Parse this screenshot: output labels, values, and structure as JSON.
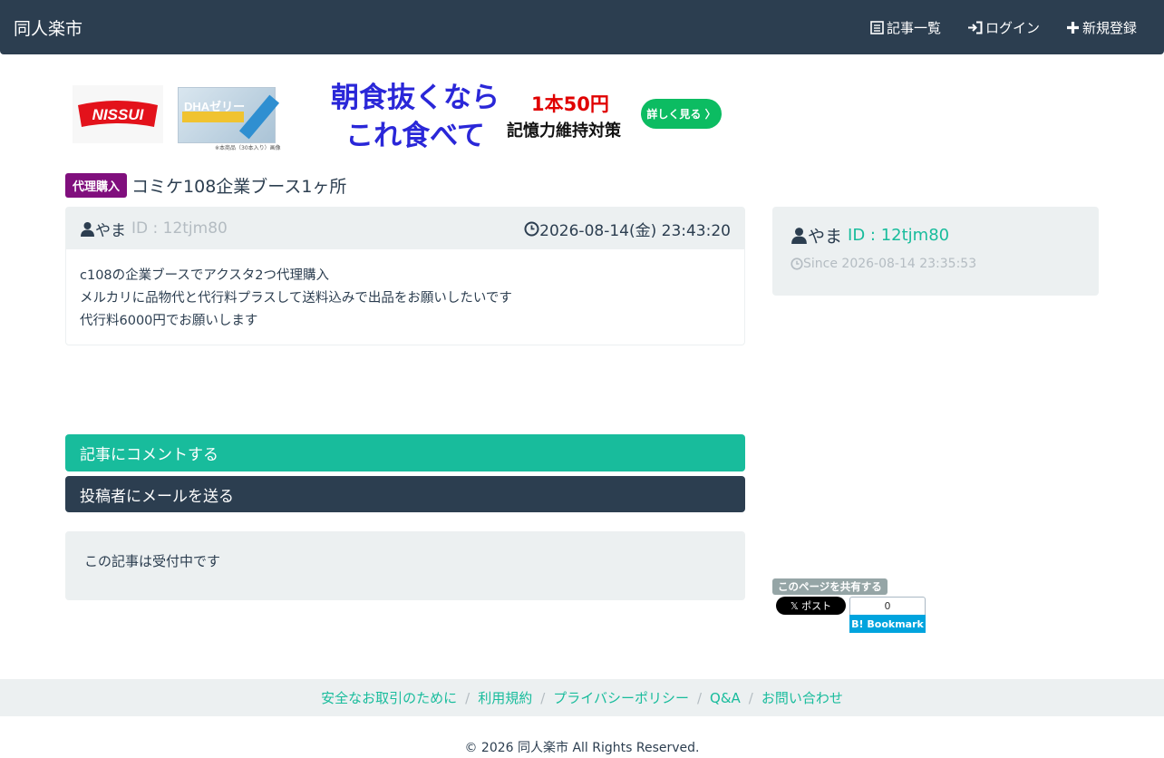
{
  "header": {
    "brand": "同人楽市",
    "nav": [
      {
        "label": "記事一覧",
        "icon": "list-icon"
      },
      {
        "label": "ログイン",
        "icon": "login-icon"
      },
      {
        "label": "新規登録",
        "icon": "plus-icon"
      }
    ]
  },
  "ad": {
    "logo_text": "NISSUI",
    "product_text": "DHAゼリー",
    "product_note": "※本商品（30本入り）画像",
    "headline_line1": "朝食抜くなら",
    "headline_line2": "これ食べて",
    "price": "1本50円",
    "sub": "記憶力維持対策",
    "cta": "詳しく見る 〉"
  },
  "post": {
    "category": "代理購入",
    "title": "コミケ108企業ブース1ヶ所",
    "user_name": "やま",
    "user_id": "ID : 12tjm80",
    "date": "2026-08-14(金) 23:43:20",
    "body_lines": [
      "c108の企業ブースでアクスタ2つ代理購入",
      "メルカリに品物代と代行料プラスして送料込みで出品をお願いしたいです",
      "代行料6000円でお願いします"
    ]
  },
  "actions": {
    "comment": "記事にコメントする",
    "mail": "投稿者にメールを送る"
  },
  "status": "この記事は受付中です",
  "sidebar": {
    "user_name": "やま",
    "user_id": "ID : 12tjm80",
    "since": "Since 2026-08-14 23:35:53"
  },
  "share": {
    "label": "このページを共有する",
    "x_label": "𝕏 ポスト",
    "hatena_count": "0",
    "hatena_label": "B! Bookmark"
  },
  "footer": {
    "links": [
      "安全なお取引のために",
      "利用規約",
      "プライバシーポリシー",
      "Q&A",
      "お問い合わせ"
    ],
    "copyright": "© 2026 同人楽市 All Rights Reserved."
  },
  "colors": {
    "navbar": "#2c3e50",
    "accent": "#18bc9c",
    "category_badge": "#800f7d",
    "well": "#ecf0f1"
  }
}
